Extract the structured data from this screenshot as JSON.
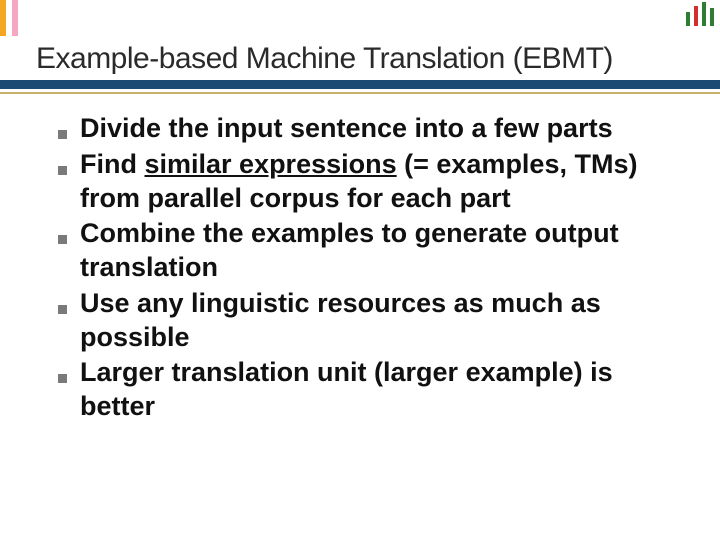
{
  "slide": {
    "title": "Example-based Machine Translation (EBMT)",
    "bullets": [
      {
        "html": "Divide the input sentence into a few parts"
      },
      {
        "html": "Find <span class=\"ul\">similar expressions</span> (= examples, TMs) from parallel corpus for each part"
      },
      {
        "html": "Combine the examples to generate output translation"
      },
      {
        "html": "Use any linguistic resources as much as possible"
      },
      {
        "html": "Larger translation unit (larger example) is better"
      }
    ]
  }
}
